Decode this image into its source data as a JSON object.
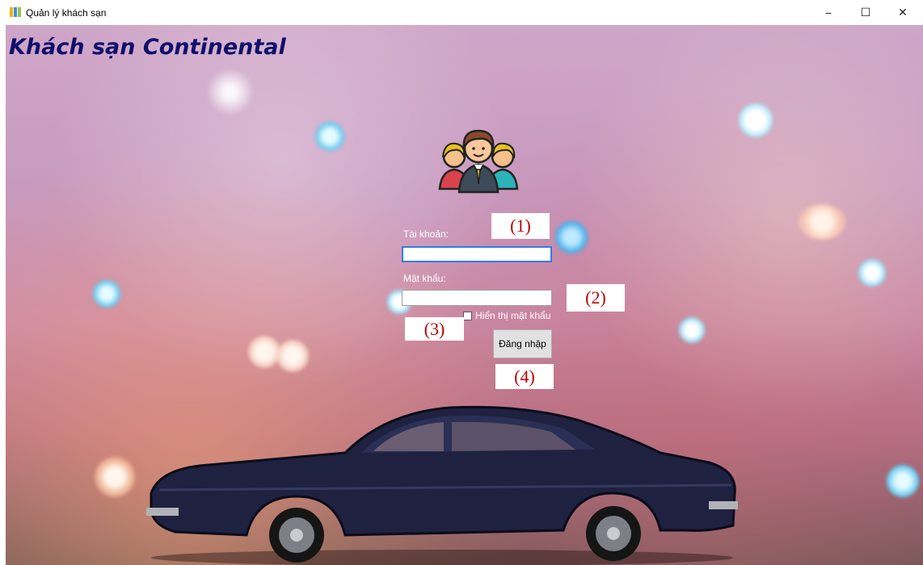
{
  "window": {
    "title": "Quản lý khách sạn",
    "controls": {
      "minimize": "−",
      "maximize": "☐",
      "close": "✕"
    }
  },
  "header": {
    "hotel_name": "Khách sạn Continental"
  },
  "login_form": {
    "username_label": "Tài khoản:",
    "username_value": "",
    "password_label": "Mật khẩu:",
    "password_value": "",
    "show_password_label": "Hiển thị mật khẩu",
    "show_password_checked": false,
    "login_button": "Đăng nhập"
  },
  "annotations": [
    "(1)",
    "(2)",
    "(3)",
    "(4)"
  ],
  "icons": {
    "logo": "users-group-icon",
    "background": "car-bokeh-photo"
  },
  "colors": {
    "hotel_title": "#0f0f6b",
    "annotation_text": "#c00000",
    "input_focus_border": "#3a7be0"
  }
}
